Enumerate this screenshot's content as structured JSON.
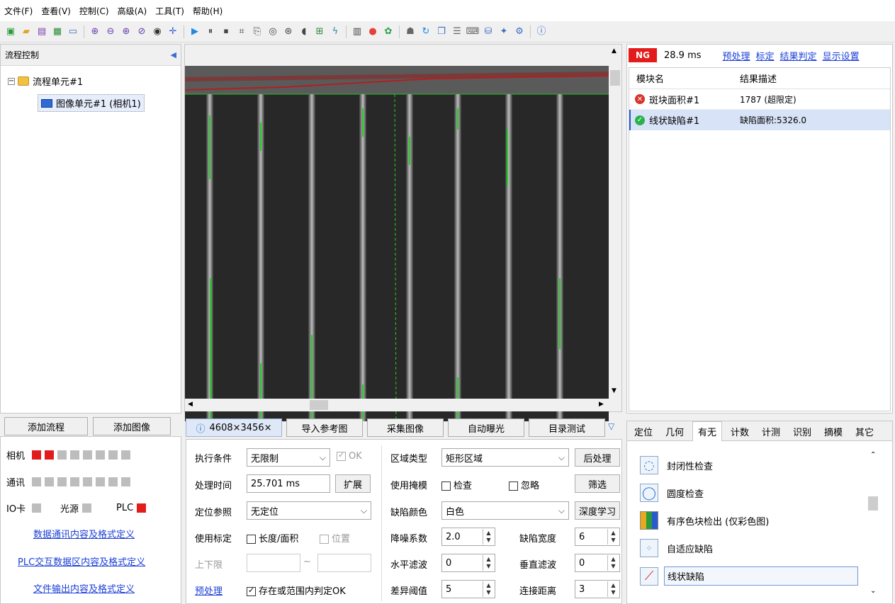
{
  "menu": [
    "文件(F)",
    "查看(V)",
    "控制(C)",
    "高级(A)",
    "工具(T)",
    "帮助(H)"
  ],
  "flow_panel": {
    "title": "流程控制",
    "unit": "流程单元#1",
    "image_unit": "图像单元#1 (相机1)",
    "add_flow": "添加流程",
    "add_image": "添加图像"
  },
  "status_panel": {
    "camera": "相机",
    "comm": "通讯",
    "io": "IO卡",
    "light": "光源",
    "plc": "PLC",
    "link1": "数据通讯内容及格式定义",
    "link2": "PLC交互数据区内容及格式定义",
    "link3": "文件输出内容及格式定义"
  },
  "image_view": {
    "resolution": "4608×3456×",
    "import_ref": "导入参考图",
    "capture": "采集图像",
    "auto_exposure": "自动曝光",
    "dir_test": "目录测试"
  },
  "results": {
    "status": "NG",
    "time": "28.9 ms",
    "links": [
      "预处理",
      "标定",
      "结果判定",
      "显示设置"
    ],
    "col_module": "模块名",
    "col_desc": "结果描述",
    "rows": [
      {
        "name": "斑块面积#1",
        "desc": "1787 (超限定)",
        "status": "fail"
      },
      {
        "name": "线状缺陷#1",
        "desc": "缺陷面积:5326.0",
        "status": "pass"
      }
    ]
  },
  "params": {
    "exec_cond_label": "执行条件",
    "exec_cond_value": "无限制",
    "ok_label": "OK",
    "proc_time_label": "处理时间",
    "proc_time_value": "25.701 ms",
    "expand": "扩展",
    "locate_label": "定位参照",
    "locate_value": "无定位",
    "calib_label": "使用标定",
    "calib_len": "长度/面积",
    "calib_pos": "位置",
    "limit_label": "上下限",
    "limit_sep": "~",
    "preprocess": "预处理",
    "exist_judge": "存在或范围内判定OK",
    "region_type_label": "区域类型",
    "region_type_value": "矩形区域",
    "post_process": "后处理",
    "use_mask_label": "使用掩模",
    "check": "检查",
    "ignore": "忽略",
    "filter": "筛选",
    "defect_color_label": "缺陷颜色",
    "defect_color_value": "白色",
    "deep_learning": "深度学习",
    "noise_label": "降噪系数",
    "noise_value": "2.0",
    "width_label": "缺陷宽度",
    "width_value": "6",
    "hfilter_label": "水平滤波",
    "hfilter_value": "0",
    "vfilter_label": "垂直滤波",
    "vfilter_value": "0",
    "diff_label": "差异阈值",
    "diff_value": "5",
    "conn_label": "连接距离",
    "conn_value": "3"
  },
  "tools_panel": {
    "tabs": [
      "定位",
      "几何",
      "有无",
      "计数",
      "计测",
      "识别",
      "摘模",
      "其它"
    ],
    "items": [
      "封闭性检查",
      "圆度检查",
      "有序色块检出 (仅彩色图)",
      "自适应缺陷",
      "线状缺陷"
    ]
  }
}
